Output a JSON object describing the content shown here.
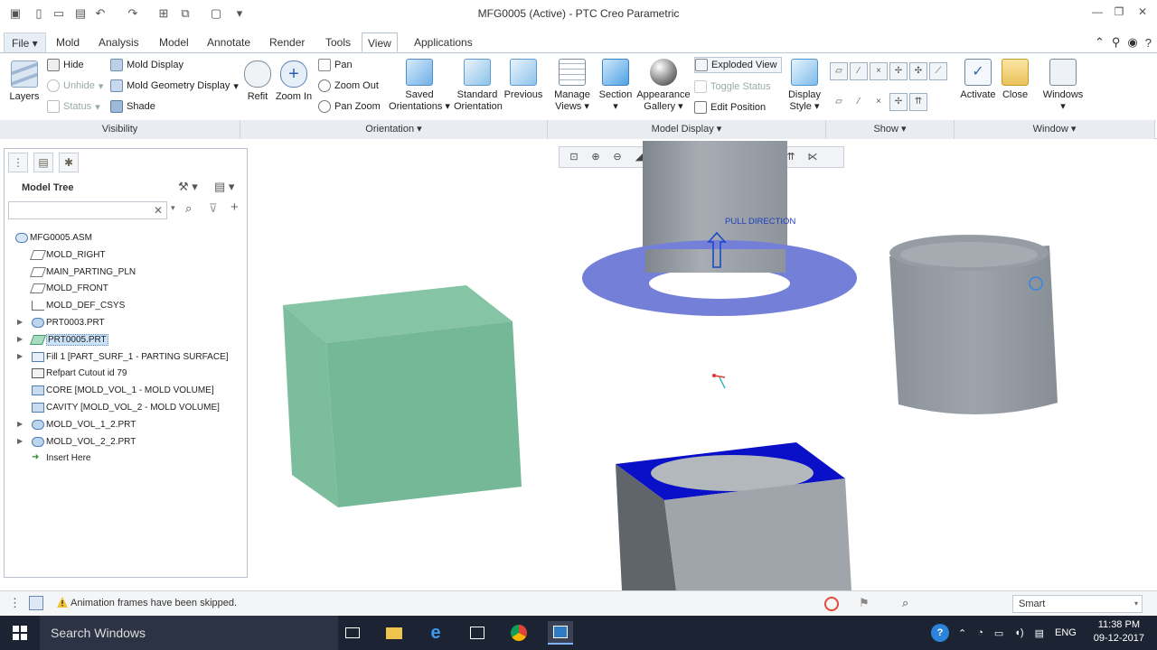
{
  "window": {
    "title": "MFG0005 (Active) - PTC Creo Parametric",
    "controls": [
      "minimize-icon",
      "restore-icon",
      "close-icon"
    ]
  },
  "tabs": [
    {
      "label": "File",
      "active": false
    },
    {
      "label": "Mold",
      "active": false
    },
    {
      "label": "Analysis",
      "active": false
    },
    {
      "label": "Model",
      "active": false
    },
    {
      "label": "Annotate",
      "active": false
    },
    {
      "label": "Render",
      "active": false
    },
    {
      "label": "Tools",
      "active": false
    },
    {
      "label": "View",
      "active": true
    },
    {
      "label": "Applications",
      "active": false
    }
  ],
  "ribbon": {
    "visibility": {
      "layers": "Layers",
      "hide": "Hide",
      "unhide": "Unhide",
      "status": "Status",
      "mold_display": "Mold Display",
      "mold_geometry_display": "Mold Geometry Display",
      "shade": "Shade",
      "group": "Visibility"
    },
    "orientation": {
      "refit": "Refit",
      "zoom_in": "Zoom In",
      "pan": "Pan",
      "zoom_out": "Zoom Out",
      "pan_zoom": "Pan Zoom",
      "saved_orientations_1": "Saved",
      "saved_orientations_2": "Orientations",
      "standard_orientation_1": "Standard",
      "standard_orientation_2": "Orientation",
      "previous": "Previous",
      "group": "Orientation"
    },
    "model_display": {
      "manage_views_1": "Manage",
      "manage_views_2": "Views",
      "section": "Section",
      "appearance_gallery_1": "Appearance",
      "appearance_gallery_2": "Gallery",
      "exploded_view": "Exploded View",
      "toggle_status": "Toggle Status",
      "edit_position": "Edit Position",
      "display_style_1": "Display",
      "display_style_2": "Style",
      "group": "Model Display"
    },
    "show": {
      "group": "Show"
    },
    "window": {
      "activate": "Activate",
      "close": "Close",
      "windows": "Windows",
      "group": "Window"
    }
  },
  "model_tree": {
    "title": "Model Tree",
    "search_placeholder": "",
    "items": [
      {
        "label": "MFG0005.ASM",
        "icon": "assembly-icon",
        "expandable": false,
        "selected": false
      },
      {
        "label": "MOLD_RIGHT",
        "icon": "datum-plane-icon",
        "expandable": false,
        "selected": false
      },
      {
        "label": "MAIN_PARTING_PLN",
        "icon": "datum-plane-icon",
        "expandable": false,
        "selected": false
      },
      {
        "label": "MOLD_FRONT",
        "icon": "datum-plane-icon",
        "expandable": false,
        "selected": false
      },
      {
        "label": "MOLD_DEF_CSYS",
        "icon": "csys-icon",
        "expandable": false,
        "selected": false
      },
      {
        "label": "PRT0003.PRT",
        "icon": "part-icon",
        "expandable": true,
        "selected": false
      },
      {
        "label": "PRT0005.PRT",
        "icon": "workpiece-icon",
        "expandable": true,
        "selected": true
      },
      {
        "label": "Fill 1 [PART_SURF_1 - PARTING SURFACE]",
        "icon": "surface-icon",
        "expandable": true,
        "selected": false
      },
      {
        "label": "Refpart Cutout id 79",
        "icon": "cutout-icon",
        "expandable": false,
        "selected": false
      },
      {
        "label": "CORE [MOLD_VOL_1 - MOLD VOLUME]",
        "icon": "volume-icon",
        "expandable": false,
        "selected": false
      },
      {
        "label": "CAVITY [MOLD_VOL_2 - MOLD VOLUME]",
        "icon": "volume-icon",
        "expandable": false,
        "selected": false
      },
      {
        "label": "MOLD_VOL_1_2.PRT",
        "icon": "part-icon",
        "expandable": true,
        "selected": false
      },
      {
        "label": "MOLD_VOL_2_2.PRT",
        "icon": "part-icon",
        "expandable": true,
        "selected": false
      },
      {
        "label": "Insert Here",
        "icon": "insert-arrow-icon",
        "expandable": false,
        "selected": false
      }
    ]
  },
  "canvas": {
    "annotation": "PULL DIRECTION"
  },
  "statusbar": {
    "message": "Animation frames have been skipped.",
    "filter": "Smart"
  },
  "taskbar": {
    "search": "Search Windows",
    "language": "ENG",
    "time": "11:38 PM",
    "date": "09-12-2017"
  },
  "colors": {
    "accent": "#1e6fc2",
    "workpiece": "#7fbfa0",
    "parting_surface": "#6f7fd6",
    "cavity_top": "#0a10c8",
    "part_grey": "#8a9198"
  }
}
